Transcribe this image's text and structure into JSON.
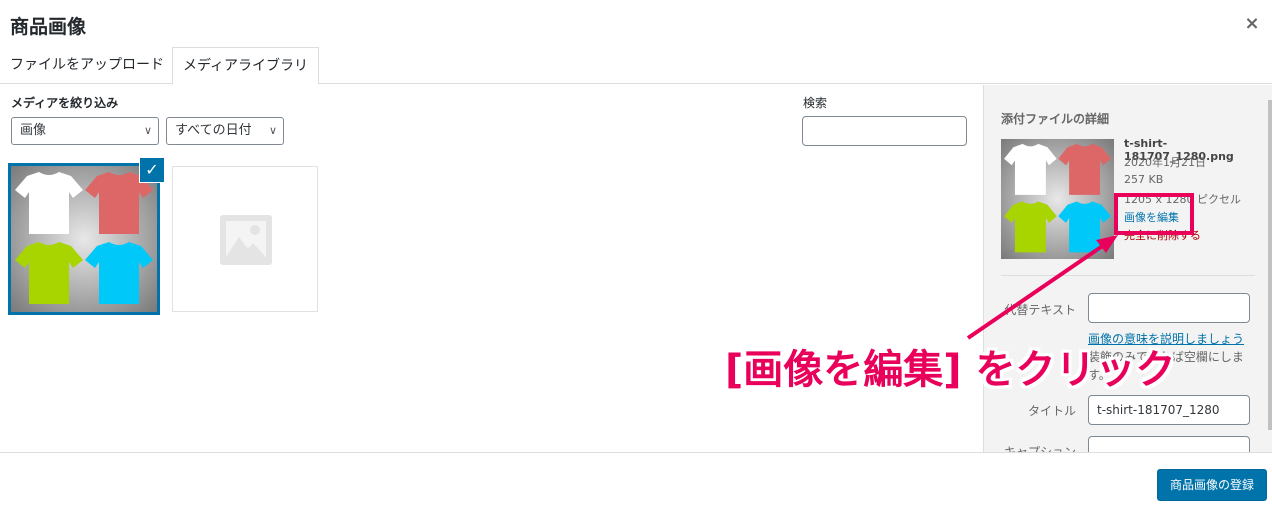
{
  "modal": {
    "title": "商品画像",
    "close_label": "×"
  },
  "tabs": [
    {
      "label": "ファイルをアップロード"
    },
    {
      "label": "メディアライブラリ"
    }
  ],
  "filters": {
    "label": "メディアを絞り込み",
    "type_value": "画像",
    "date_value": "すべての日付"
  },
  "search": {
    "label": "検索",
    "value": ""
  },
  "attachment": {
    "title": "添付ファイルの詳細",
    "filename": "t-shirt-181707_1280.png",
    "date": "2020年1月21日",
    "size": "257 KB",
    "dimensions": "1205 x 1280 ピクセル",
    "edit_link": "画像を編集",
    "delete_link": "完全に削除する"
  },
  "fields": {
    "alt_label": "代替テキスト",
    "alt_value": "",
    "alt_help_link": "画像の意味を説明しましょう",
    "alt_help_text": "装飾のみであれば空欄にします。",
    "title_label": "タイトル",
    "title_value": "t-shirt-181707_1280",
    "caption_label": "キャプション",
    "caption_value": ""
  },
  "footer": {
    "primary_button": "商品画像の登録"
  },
  "annotation": {
    "text": "[画像を編集] をクリック",
    "color": "#e8005a"
  },
  "colors": {
    "accent": "#0073aa",
    "tshirt_white": "#ffffff",
    "tshirt_red": "#dd6666",
    "tshirt_green": "#a8d400",
    "tshirt_cyan": "#00c8f8"
  }
}
